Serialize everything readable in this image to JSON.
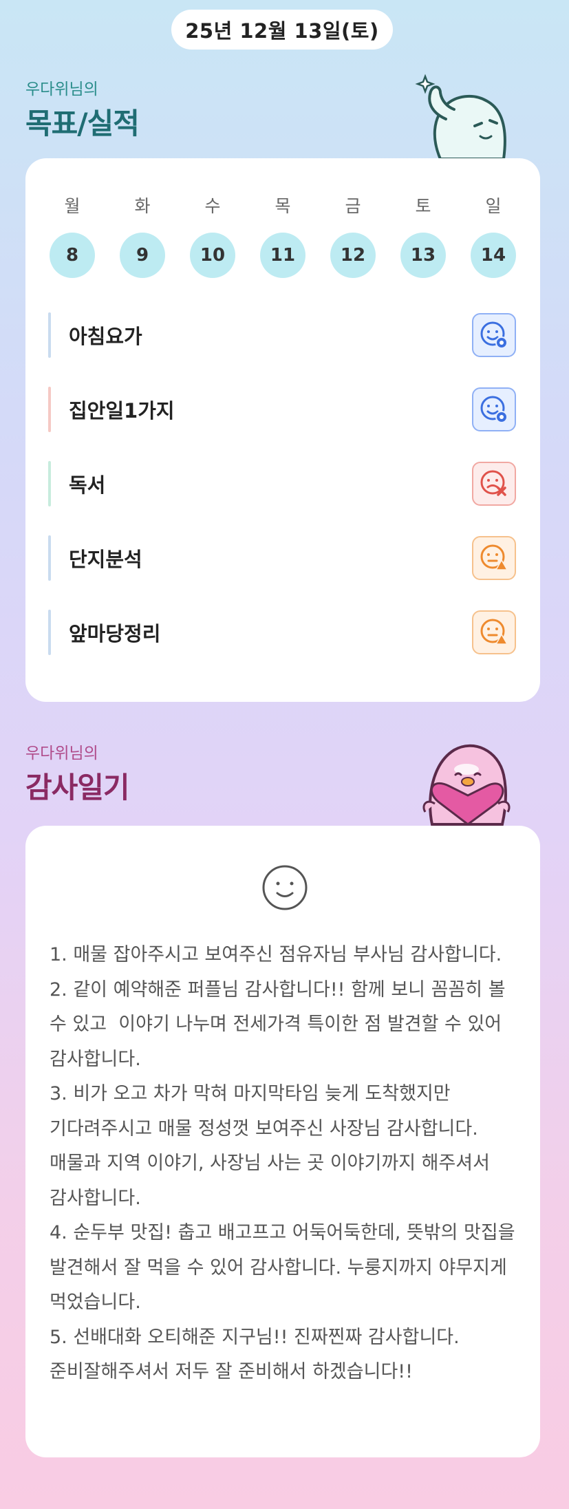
{
  "header": {
    "date": "25년 12월 13일(토)"
  },
  "goals_section": {
    "subtitle": "우다위님의",
    "title": "목표/실적",
    "week": [
      {
        "dow": "월",
        "date": "8"
      },
      {
        "dow": "화",
        "date": "9"
      },
      {
        "dow": "수",
        "date": "10"
      },
      {
        "dow": "목",
        "date": "11"
      },
      {
        "dow": "금",
        "date": "12"
      },
      {
        "dow": "토",
        "date": "13"
      },
      {
        "dow": "일",
        "date": "14"
      }
    ],
    "goals": [
      {
        "label": "아침요가",
        "bar_color": "#c9dbef",
        "status": "done",
        "status_color": "#3b6fe0",
        "icon": "smile-check-icon"
      },
      {
        "label": "집안일1가지",
        "bar_color": "#f5c9c4",
        "status": "done",
        "status_color": "#3b6fe0",
        "icon": "smile-check-icon"
      },
      {
        "label": "독서",
        "bar_color": "#c7ecdd",
        "status": "failed",
        "status_color": "#e0524a",
        "icon": "frown-x-icon"
      },
      {
        "label": "단지분석",
        "bar_color": "#c9dbef",
        "status": "partial",
        "status_color": "#ee8a2e",
        "icon": "neutral-warning-icon"
      },
      {
        "label": "앞마당정리",
        "bar_color": "#c9dbef",
        "status": "partial",
        "status_color": "#ee8a2e",
        "icon": "neutral-warning-icon"
      }
    ]
  },
  "diary_section": {
    "subtitle": "우다위님의",
    "title": "감사일기",
    "mood_icon": "smiley-face-icon",
    "text": "1. 매물 잡아주시고 보여주신 점유자님 부사님 감사합니다.\n2. 같이 예약해준 퍼플님 감사합니다!! 함께 보니 꼼꼼히 볼 수 있고  이야기 나누며 전세가격 특이한 점 발견할 수 있어 감사합니다.\n3. 비가 오고 차가 막혀 마지막타임 늦게 도착했지만 기다려주시고 매물 정성껏 보여주신 사장님 감사합니다. 매물과 지역 이야기, 사장님 사는 곳 이야기까지 해주셔서 감사합니다.\n4. 순두부 맛집! 춥고 배고프고 어둑어둑한데, 뜻밖의 맛집을 발견해서 잘 먹을 수 있어 감사합니다. 누룽지까지 야무지게 먹었습니다.\n5. 선배대화 오티해준 지구님!! 진짜찐짜 감사합니다. 준비잘해주셔서 저두 잘 준비해서 하겠습니다!!"
  },
  "colors": {
    "accent_teal": "#1f6d73",
    "accent_pink": "#8a2a63",
    "day_circle": "#bdebf2"
  }
}
